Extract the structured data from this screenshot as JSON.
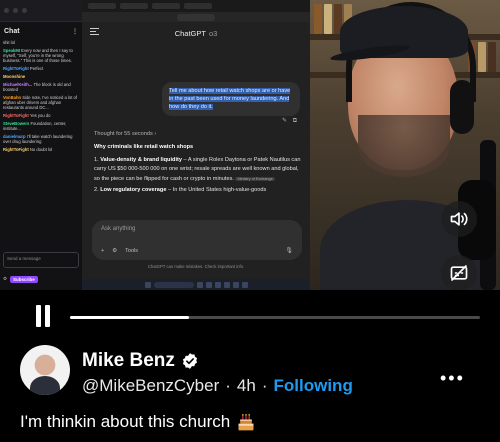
{
  "video": {
    "stream_chat": {
      "header": "Chat",
      "lines": [
        {
          "user": "",
          "text": "shit lol"
        },
        {
          "user": "SpeakMI",
          "text": "Every now and then I say to myself, \"Self, you're in the wrong business.\" This is one of those times."
        },
        {
          "user": "RightToFight",
          "text": "Perfect"
        },
        {
          "user": "Moonshine",
          "text": ""
        },
        {
          "user": "MichaelKeith...",
          "text": "The block is old and boosted"
        },
        {
          "user": "VonBahn",
          "text": "Side note, I've noticed a lot of afghan uber drivers and afghan restaurants around DC..."
        },
        {
          "user": "RightToFight",
          "text": "Yes you do"
        },
        {
          "user": "SteveBowers",
          "text": "Foundation, center, institute..."
        },
        {
          "user": "danielmurp",
          "text": "I'll take watch laundering over drug laundering"
        },
        {
          "user": "RightToFight",
          "text": "No doubt lol"
        }
      ],
      "input_placeholder": "Send a message",
      "subscribe_label": "Subscribe"
    },
    "chatgpt": {
      "title": "ChatGPT",
      "model": "o3",
      "user_message": "Tell me about how retail watch shops are or have in the past been used for money laundering. And how do they do it.",
      "thought_label": "Thought for 55 seconds",
      "answer_heading": "Why criminals like retail watch shops",
      "answer_items": [
        {
          "num": "1.",
          "title": "Value-density & brand liquidity",
          "text": "– A single Rolex Daytona or Patek Nautilus can carry US $50 000-500 000 on one wrist; resale spreads are well known and global, so the piece can be flipped for cash or crypto in minutes.",
          "chip": "Ministry of Exchange"
        },
        {
          "num": "2.",
          "title": "Low regulatory coverage",
          "text": "– In the United States high-value-goods"
        }
      ],
      "compose_placeholder": "Ask anything",
      "tools_label": "Tools",
      "disclaimer": "ChatGPT can make mistakes. Check important info."
    }
  },
  "player": {
    "progress": 0.29
  },
  "author": {
    "name": "Mike Benz",
    "handle": "@MikeBenzCyber",
    "separator": "·",
    "time": "4h",
    "follow_state": "Following"
  },
  "post": {
    "text": "I'm thinkin about this church"
  },
  "icons": {
    "verified": "verified-badge-icon",
    "more": "more-options-icon",
    "pause": "pause-icon",
    "volume": "volume-icon",
    "captions": "captions-off-icon",
    "emoji": "birthday-cake-emoji"
  },
  "colors": {
    "accent": "#1d9bf0",
    "background": "#000000"
  }
}
